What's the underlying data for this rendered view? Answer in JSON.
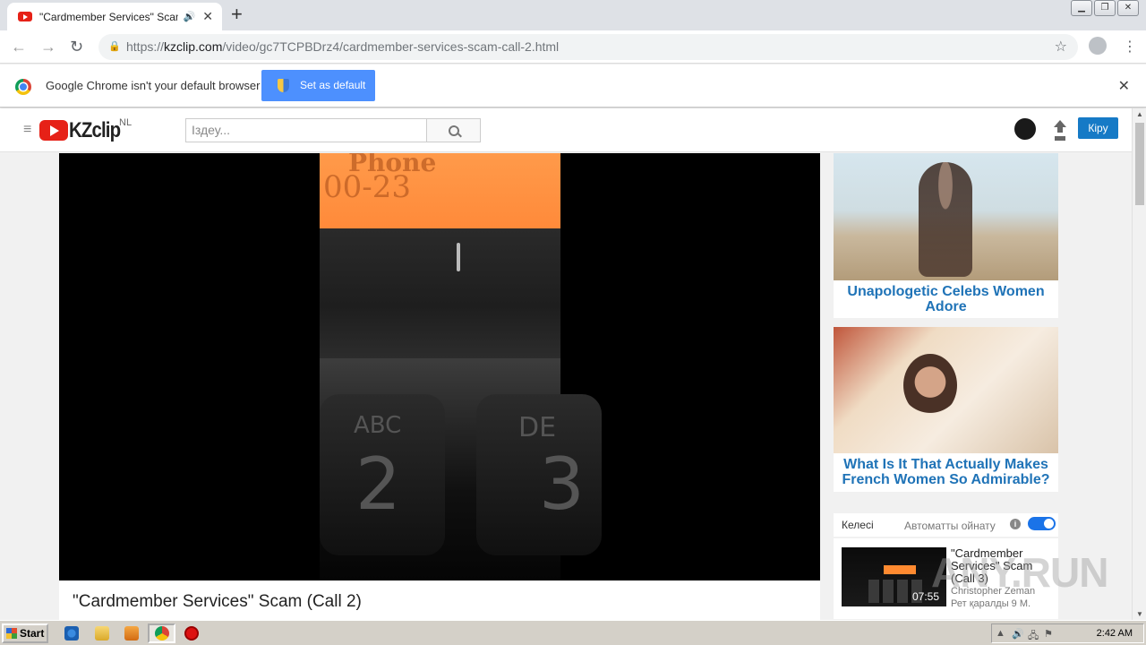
{
  "browser": {
    "tab_title": "\"Cardmember Services\" Scam (C",
    "url_scheme": "https://",
    "url_host": "kzclip.com",
    "url_path": "/video/gc7TCPBDrz4/cardmember-services-scam-call-2.html",
    "infobar_text": "Google Chrome isn't your default browser",
    "set_default_label": "Set as default"
  },
  "site": {
    "logo_text": "KZclip",
    "region": "NL",
    "search_placeholder": "Іздеу...",
    "login_label": "Кіру"
  },
  "video": {
    "lcd_line1": "Phone",
    "lcd_line2": "00-23",
    "key1_letters": "ABC",
    "key1_digit": "2",
    "key2_letters": "DE",
    "key2_digit": "3",
    "title": "\"Cardmember Services\" Scam (Call 2)"
  },
  "rail": {
    "ads": [
      {
        "caption": "Unapologetic Celebs Women Adore"
      },
      {
        "caption": "What Is It That Actually Makes French Women So Admirable?"
      }
    ],
    "next_label": "Келесі",
    "autoplay_label": "Автоматты ойнату",
    "autoplay_on": true,
    "next_video": {
      "title": "\"Cardmember Services\" Scam (Call 3)",
      "author": "Christopher Zeman",
      "views": "Рет қаралды 9 М.",
      "duration": "07:55"
    }
  },
  "watermark": "ANY.RUN",
  "taskbar": {
    "start_label": "Start",
    "clock": "2:42 AM"
  },
  "colors": {
    "accent_blue": "#167ac6",
    "ad_caption": "#1f73b7",
    "brand_red": "#e62117"
  }
}
